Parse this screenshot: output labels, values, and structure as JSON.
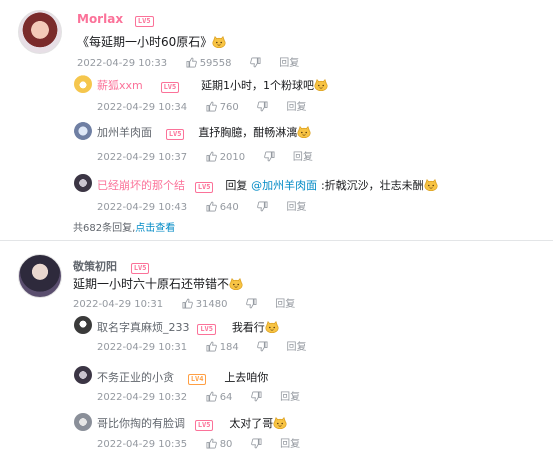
{
  "comment1": {
    "username": "Morlax",
    "level": "LV5",
    "text": "《每延期一小时60原石》",
    "date": "2022-04-29 10:33",
    "likes": "59558",
    "reply_label": "回复",
    "replies": [
      {
        "username": "薪狐xxm",
        "level": "LV5",
        "text": "延期1小时，1个粉球吧",
        "date": "2022-04-29 10:34",
        "likes": "760",
        "reply_label": "回复"
      },
      {
        "username": "加州羊肉面",
        "level": "LV5",
        "text": "直抒胸臆，酣畅淋漓",
        "date": "2022-04-29 10:37",
        "likes": "2010",
        "reply_label": "回复"
      },
      {
        "username": "已经崩坏的那个结",
        "level": "LV5",
        "reply_prefix": "回复",
        "mention": "@加州羊肉面",
        "text": ":折戟沉沙，壮志未酬",
        "date": "2022-04-29 10:43",
        "likes": "640",
        "reply_label": "回复"
      }
    ],
    "more_text": "共682条回复,",
    "more_link": "点击查看"
  },
  "comment2": {
    "username": "敬策初阳",
    "level": "LV5",
    "text": "延期一小时六十原石还带错不",
    "date": "2022-04-29 10:31",
    "likes": "31480",
    "reply_label": "回复",
    "replies": [
      {
        "username": "取名字真麻烦_233",
        "level": "LV5",
        "text": "我看行",
        "date": "2022-04-29 10:31",
        "likes": "184",
        "reply_label": "回复"
      },
      {
        "username": "不务正业的小贪",
        "level": "LV4",
        "text": "上去咱你",
        "date": "2022-04-29 10:32",
        "likes": "64",
        "reply_label": "回复"
      },
      {
        "username": "哥比你掏的有脸调",
        "level": "LV5",
        "text": "太对了哥",
        "date": "2022-04-29 10:35",
        "likes": "80",
        "reply_label": "回复"
      }
    ]
  },
  "colors": {
    "pink": "#fb7299",
    "link": "#008ac5",
    "meta": "#9499a0"
  }
}
